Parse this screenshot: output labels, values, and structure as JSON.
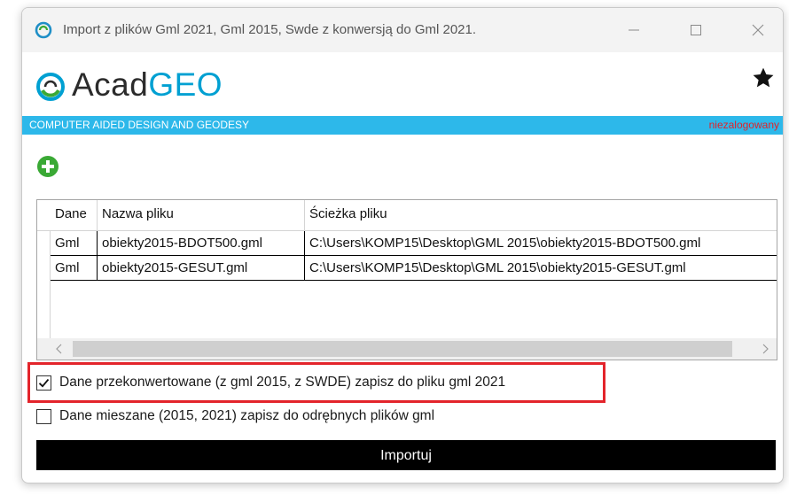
{
  "window": {
    "title": "Import z plików Gml 2021, Gml 2015, Swde z konwersją do Gml 2021."
  },
  "logo": {
    "part1": "Acad",
    "part2": "GEO"
  },
  "tagline": {
    "left": "COMPUTER AIDED DESIGN AND GEODESY",
    "right": "niezalogowany"
  },
  "grid": {
    "columns": [
      "Dane",
      "Nazwa pliku",
      "Ścieżka pliku"
    ],
    "rows": [
      {
        "dane": "Gml",
        "nazwa": "obiekty2015-BDOT500.gml",
        "sciezka": "C:\\Users\\KOMP15\\Desktop\\GML 2015\\obiekty2015-BDOT500.gml"
      },
      {
        "dane": "Gml",
        "nazwa": "obiekty2015-GESUT.gml",
        "sciezka": "C:\\Users\\KOMP15\\Desktop\\GML 2015\\obiekty2015-GESUT.gml"
      }
    ]
  },
  "options": {
    "convert_label": "Dane przekonwertowane (z gml 2015, z SWDE) zapisz do pliku gml 2021",
    "convert_checked": true,
    "mixed_label": "Dane mieszane (2015, 2021) zapisz do odrębnych plików gml",
    "mixed_checked": false
  },
  "import_button": "Importuj",
  "colors": {
    "accent_bar": "#2db8ea",
    "logo_blue": "#00a0d2",
    "status_red": "#e0242a",
    "add_green": "#3aa935",
    "highlight_red": "#e3242b"
  },
  "icons": {
    "app": "acadgeo-app-icon",
    "favorite": "star-icon",
    "add": "plus-circle-icon"
  }
}
